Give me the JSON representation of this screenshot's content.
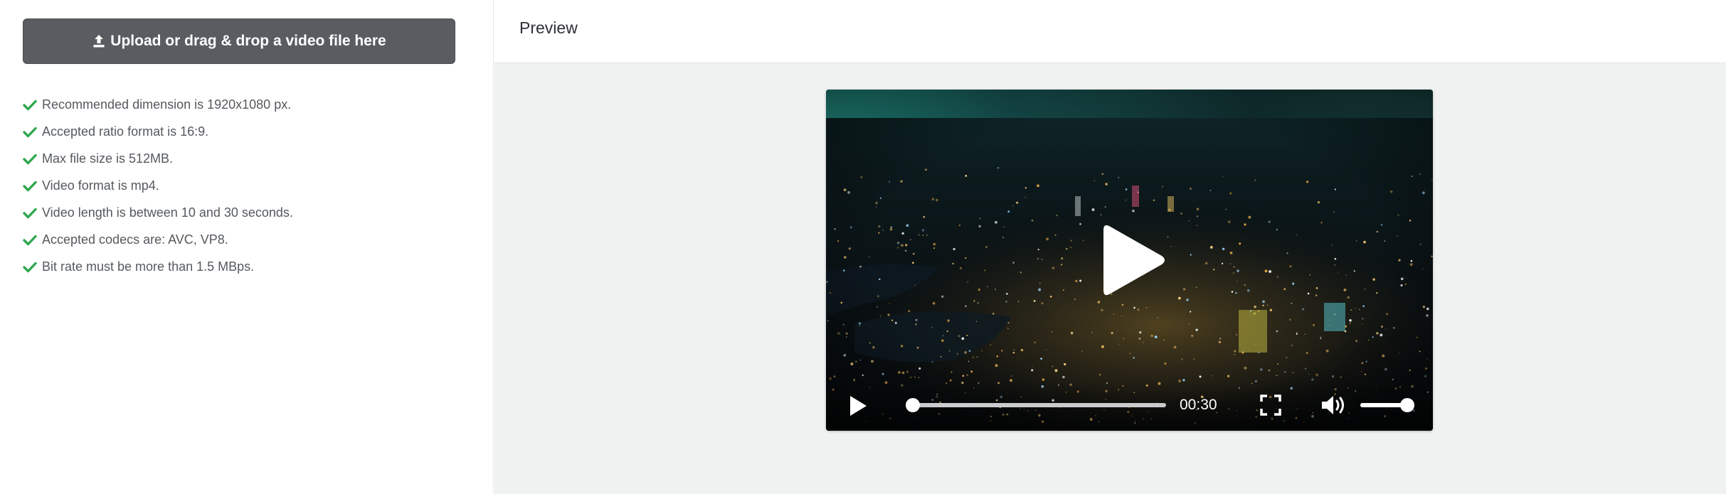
{
  "upload": {
    "label": "Upload or drag & drop a video file here",
    "icon": "upload-icon"
  },
  "requirements": [
    "Recommended dimension is 1920x1080 px.",
    "Accepted ratio format is 16:9.",
    "Max file size is 512MB.",
    "Video format is mp4.",
    "Video length is between 10 and 30 seconds.",
    "Accepted codecs are: AVC, VP8.",
    "Bit rate must be more than 1.5 MBps."
  ],
  "preview": {
    "title": "Preview"
  },
  "player": {
    "time": "00:30",
    "seek_progress": 0.0,
    "volume_level": 1.0,
    "icons": [
      "play-icon",
      "fullscreen-icon",
      "volume-icon"
    ]
  },
  "colors": {
    "check": "#2fa84f",
    "upload_button": "#595d62",
    "preview_background": "#f0f1f1"
  }
}
